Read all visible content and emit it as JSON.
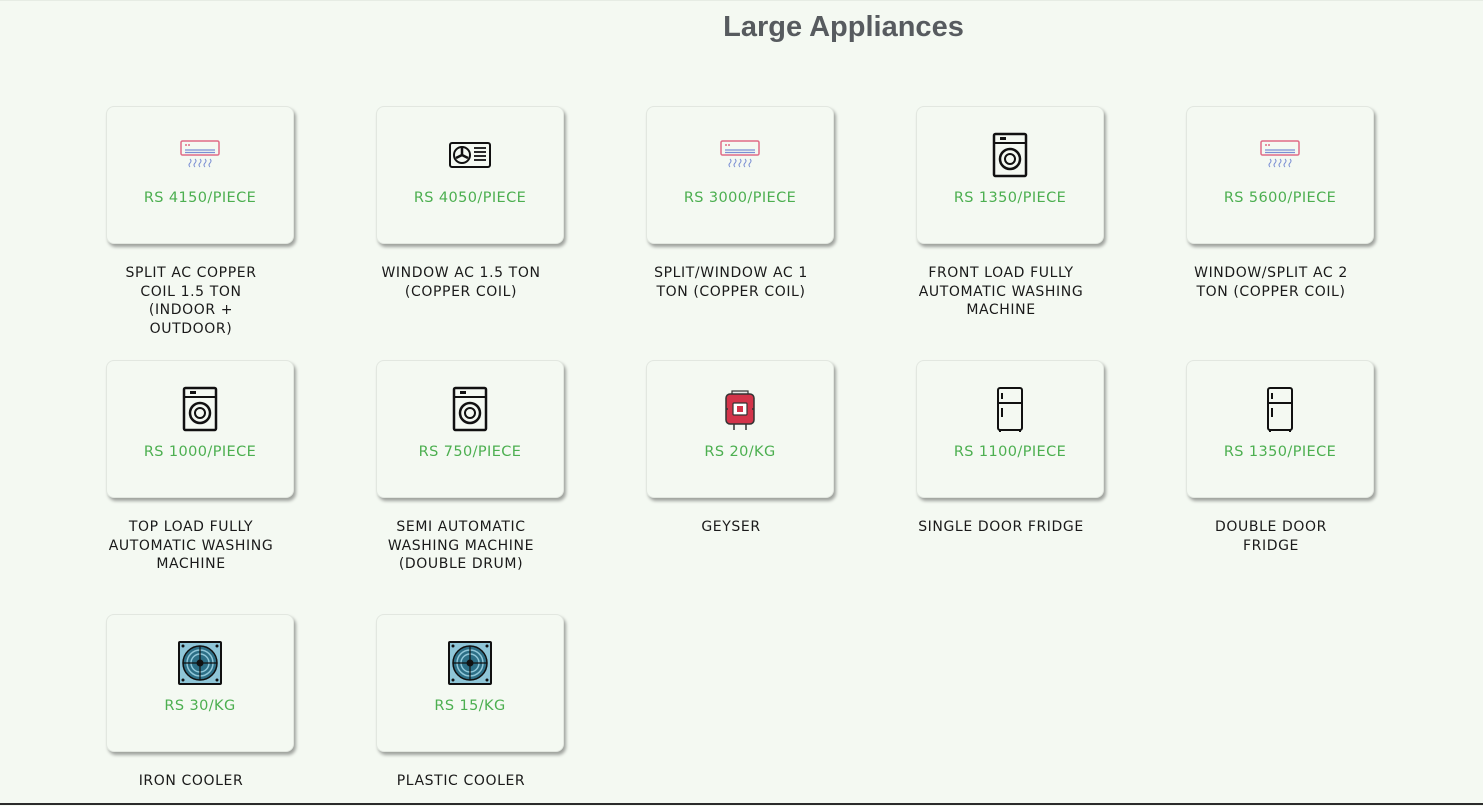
{
  "page": {
    "title": "Large Appliances"
  },
  "products": [
    {
      "price": "RS 4150/PIECE",
      "name": "SPLIT AC COPPER COIL 1.5 TON (INDOOR + OUTDOOR)",
      "icon": "split-ac-icon"
    },
    {
      "price": "RS 4050/PIECE",
      "name": "WINDOW AC 1.5 TON (COPPER COIL)",
      "icon": "window-ac-icon"
    },
    {
      "price": "RS 3000/PIECE",
      "name": "SPLIT/WINDOW AC 1 TON (COPPER COIL)",
      "icon": "split-ac-icon"
    },
    {
      "price": "RS 1350/PIECE",
      "name": "FRONT LOAD FULLY AUTOMATIC WASHING MACHINE",
      "icon": "washing-machine-icon"
    },
    {
      "price": "RS 5600/PIECE",
      "name": "WINDOW/SPLIT AC 2 TON (COPPER COIL)",
      "icon": "split-ac-icon"
    },
    {
      "price": "RS 1000/PIECE",
      "name": "TOP LOAD FULLY AUTOMATIC WASHING MACHINE",
      "icon": "washing-machine-icon"
    },
    {
      "price": "RS 750/PIECE",
      "name": "SEMI AUTOMATIC WASHING MACHINE (DOUBLE DRUM)",
      "icon": "washing-machine-icon"
    },
    {
      "price": "RS 20/KG",
      "name": "GEYSER",
      "icon": "geyser-icon"
    },
    {
      "price": "RS 1100/PIECE",
      "name": "SINGLE DOOR FRIDGE",
      "icon": "fridge-icon"
    },
    {
      "price": "RS 1350/PIECE",
      "name": "DOUBLE DOOR FRIDGE",
      "icon": "fridge-icon"
    },
    {
      "price": "RS 30/KG",
      "name": "IRON COOLER",
      "icon": "cooler-icon"
    },
    {
      "price": "RS 15/KG",
      "name": "PLASTIC COOLER",
      "icon": "cooler-icon"
    }
  ]
}
